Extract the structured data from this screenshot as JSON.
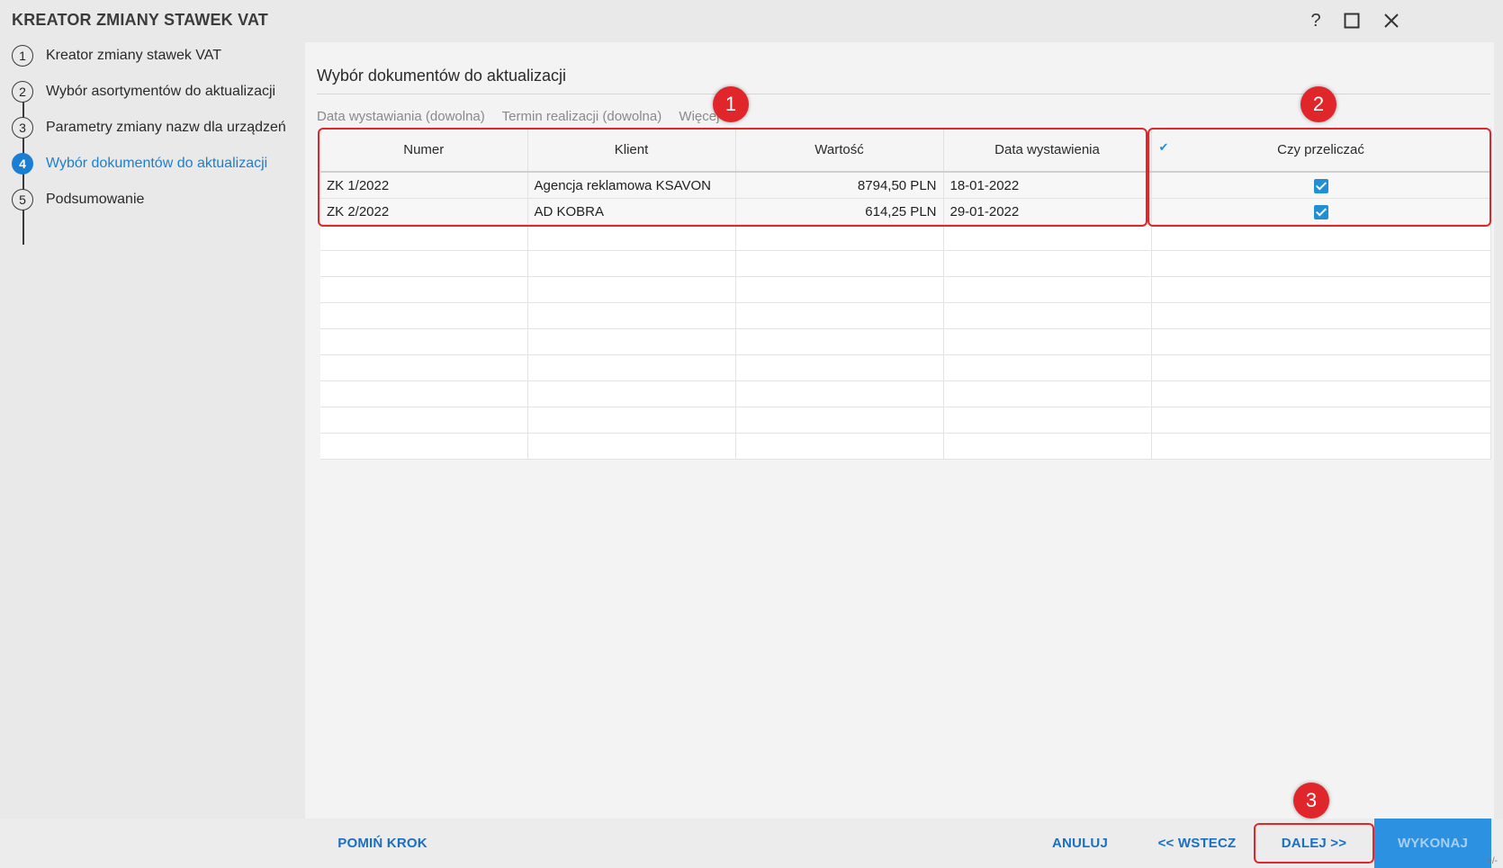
{
  "window": {
    "title": "KREATOR ZMIANY STAWEK VAT",
    "controls": {
      "help": "?",
      "maximize": "☐",
      "close": "✕"
    }
  },
  "sidebar": {
    "steps": [
      {
        "num": "1",
        "label": "Kreator zmiany stawek VAT",
        "active": false
      },
      {
        "num": "2",
        "label": "Wybór asortymentów do aktualizacji",
        "active": false
      },
      {
        "num": "3",
        "label": "Parametry zmiany nazw dla urządzeń",
        "active": false
      },
      {
        "num": "4",
        "label": "Wybór dokumentów do aktualizacji",
        "active": true
      },
      {
        "num": "5",
        "label": "Podsumowanie",
        "active": false
      }
    ]
  },
  "main": {
    "heading": "Wybór dokumentów do aktualizacji",
    "filters": [
      "Data wystawiania (dowolna)",
      "Termin realizacji (dowolna)",
      "Więcej"
    ],
    "table": {
      "columns": [
        "Numer",
        "Klient",
        "Wartość",
        "Data wystawienia",
        "Czy przeliczać"
      ],
      "rows": [
        {
          "numer": "ZK 1/2022",
          "klient": "Agencja reklamowa KSAVON",
          "wartosc": "8794,50 PLN",
          "data": "18-01-2022",
          "przeliczac": true
        },
        {
          "numer": "ZK 2/2022",
          "klient": "AD KOBRA",
          "wartosc": "614,25 PLN",
          "data": "29-01-2022",
          "przeliczac": true
        }
      ]
    }
  },
  "annotations": [
    "1",
    "2",
    "3"
  ],
  "footer": {
    "skip": "POMIŃ KROK",
    "cancel": "ANULUJ",
    "back": "<< WSTECZ",
    "next": "DALEJ >>",
    "execute": "WYKONAJ"
  },
  "colors": {
    "accent": "#1a7fd4",
    "annotation": "#e0262b",
    "checkbox": "#1f8fd6"
  }
}
